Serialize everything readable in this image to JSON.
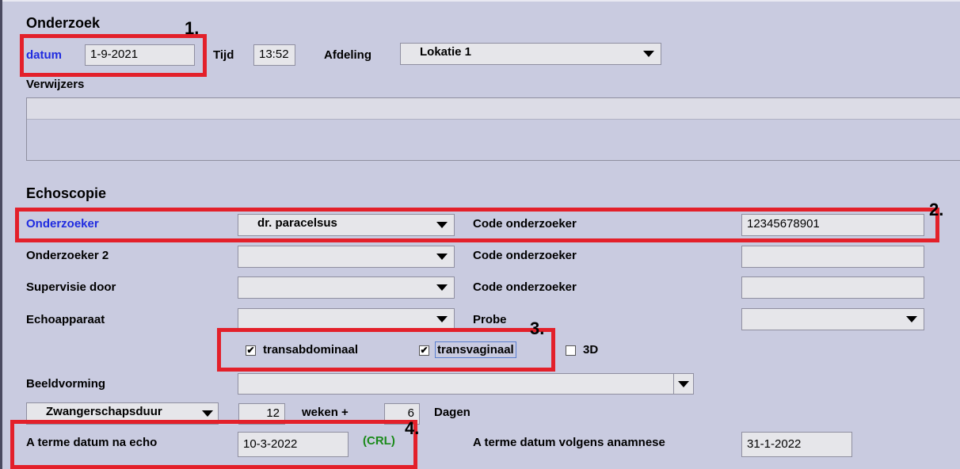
{
  "onderzoek": {
    "title": "Onderzoek",
    "datum_label": "datum",
    "datum_value": "1-9-2021",
    "tijd_label": "Tijd",
    "tijd_value": "13:52",
    "afdeling_label": "Afdeling",
    "afdeling_value": "Lokatie 1",
    "verwijzers_label": "Verwijzers"
  },
  "echoscopie": {
    "title": "Echoscopie",
    "onderzoeker_label": "Onderzoeker",
    "onderzoeker_value": "dr. paracelsus",
    "code_label": "Code onderzoeker",
    "code_value": "12345678901",
    "onderzoeker2_label": "Onderzoeker 2",
    "code2_label": "Code onderzoeker",
    "supervisie_label": "Supervisie door",
    "code3_label": "Code onderzoeker",
    "echoapparaat_label": "Echoapparaat",
    "probe_label": "Probe",
    "transabdominaal_label": "transabdominaal",
    "transvaginaal_label": "transvaginaal",
    "label_3d": "3D",
    "beeldvorming_label": "Beeldvorming",
    "zwangerschapsduur_label": "Zwangerschapsduur",
    "weken_value": "12",
    "weken_label": "weken +",
    "dagen_value": "6",
    "dagen_label": "Dagen",
    "aterme_echo_label": "A terme datum na echo",
    "aterme_echo_value": "10-3-2022",
    "crl_label": "(CRL)",
    "aterme_anamnese_label": "A terme datum volgens anamnese",
    "aterme_anamnese_value": "31-1-2022"
  },
  "checkmarks": {
    "transabdominaal": "✔",
    "transvaginaal": "✔",
    "d3": ""
  },
  "annotations": {
    "n1": "1.",
    "n2": "2.",
    "n3": "3.",
    "n4": "4."
  },
  "colors": {
    "background": "#c9cbe0",
    "highlight_red": "#e3202a",
    "link_blue": "#1f2be0",
    "crl_green": "#1a8a1a"
  }
}
